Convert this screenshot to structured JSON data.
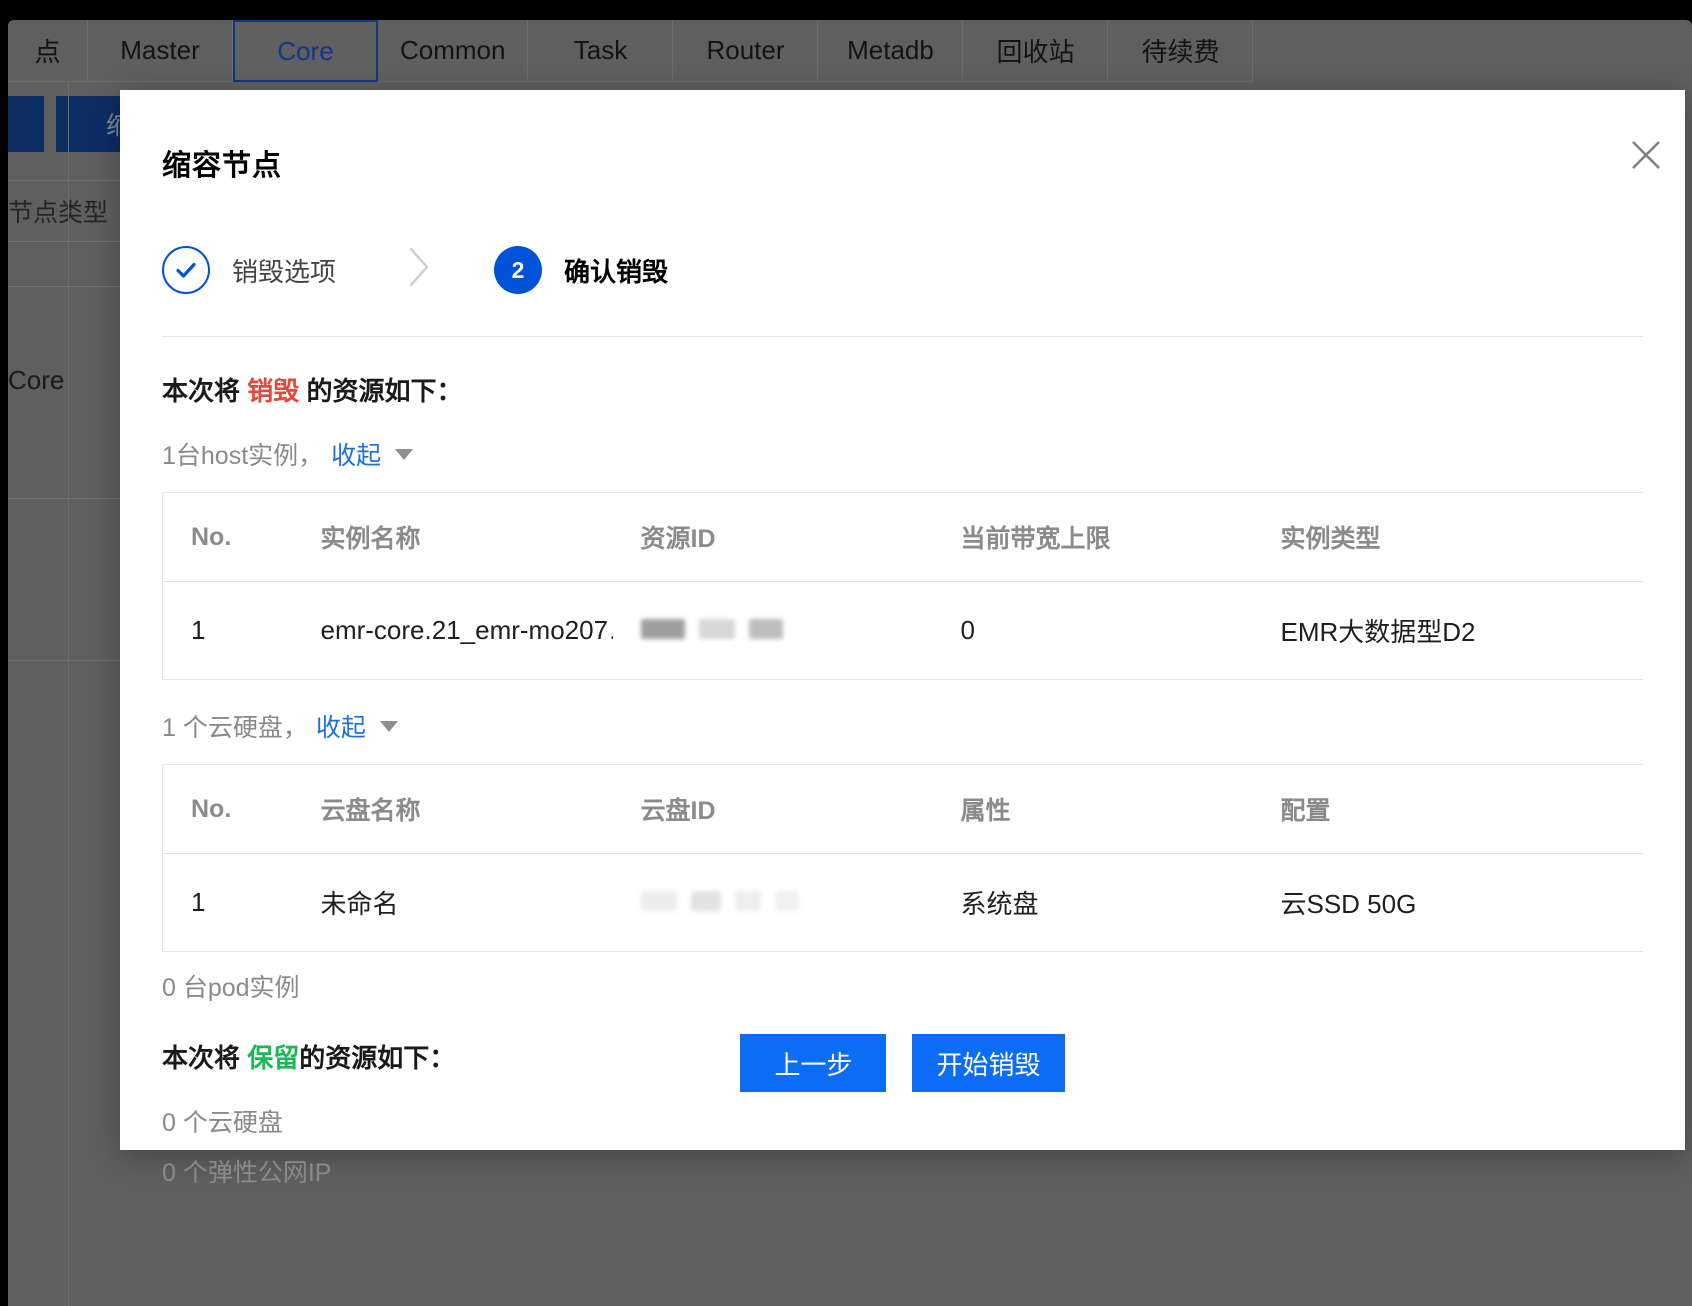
{
  "background": {
    "tabs": [
      {
        "label": "点",
        "active": false
      },
      {
        "label": "Master",
        "active": false
      },
      {
        "label": "Core",
        "active": true
      },
      {
        "label": "Common",
        "active": false
      },
      {
        "label": "Task",
        "active": false
      },
      {
        "label": "Router",
        "active": false
      },
      {
        "label": "Metadb",
        "active": false
      },
      {
        "label": "回收站",
        "active": false
      },
      {
        "label": "待续费",
        "active": false
      }
    ],
    "toolbar_button_label": "缩容",
    "column_header": "节点类型",
    "cell_node_type": "Core"
  },
  "modal": {
    "title": "缩容节点",
    "close_icon": "close-icon",
    "steps": [
      {
        "label": "销毁选项",
        "state": "done",
        "marker": "✓"
      },
      {
        "label": "确认销毁",
        "state": "current",
        "marker": "2"
      }
    ],
    "destroy_section": {
      "heading_prefix": "本次将 ",
      "heading_accent": "销毁",
      "heading_suffix": " 的资源如下：",
      "accent_color": "#e8453c",
      "host_group": {
        "count_text": "1台host实例，",
        "toggle_label": "收起",
        "columns": [
          "No.",
          "实例名称",
          "资源ID",
          "当前带宽上限",
          "实例类型"
        ],
        "rows": [
          {
            "no": "1",
            "name": "emr-core.21_emr-mo207…",
            "resource_id": "",
            "bandwidth": "0",
            "instance_type": "EMR大数据型D2"
          }
        ]
      },
      "disk_group": {
        "count_text": "1 个云硬盘，",
        "toggle_label": "收起",
        "columns": [
          "No.",
          "云盘名称",
          "云盘ID",
          "属性",
          "配置"
        ],
        "rows": [
          {
            "no": "1",
            "name": "未命名",
            "disk_id": "",
            "attribute": "系统盘",
            "config": "云SSD 50G"
          }
        ]
      },
      "pod_line": "0 台pod实例"
    },
    "keep_section": {
      "heading_prefix": "本次将 ",
      "heading_accent": "保留",
      "heading_suffix": "的资源如下：",
      "accent_color": "#19b955",
      "lines": [
        "0 个云硬盘",
        "0 个弹性公网IP"
      ]
    },
    "footer": {
      "prev_label": "上一步",
      "confirm_label": "开始销毁",
      "button_color": "#0b6cf5"
    }
  }
}
